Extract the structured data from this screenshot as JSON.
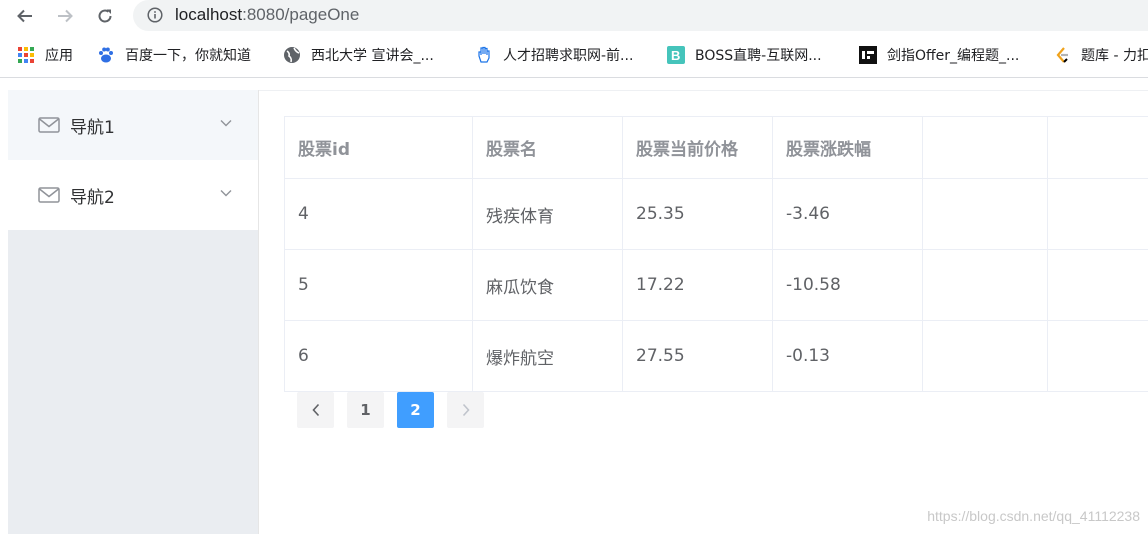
{
  "browser": {
    "url_host": "localhost",
    "url_rest": ":8080/pageOne",
    "bookmarks": [
      {
        "label": "应用",
        "icon": "apps-grid-icon"
      },
      {
        "label": "百度一下，你就知道",
        "icon": "baidu-paw-icon"
      },
      {
        "label": "西北大学 宣讲会_...",
        "icon": "globe-icon"
      },
      {
        "label": "人才招聘求职网-前...",
        "icon": "hand-icon"
      },
      {
        "label": "BOSS直聘-互联网...",
        "icon": "boss-b-icon"
      },
      {
        "label": "剑指Offer_编程题_...",
        "icon": "nowcoder-icon"
      },
      {
        "label": "题库 - 力扣",
        "icon": "leetcode-icon"
      }
    ]
  },
  "sidebar": {
    "items": [
      {
        "label": "导航1",
        "icon": "mail-icon"
      },
      {
        "label": "导航2",
        "icon": "mail-icon"
      }
    ]
  },
  "table": {
    "headers": [
      "股票id",
      "股票名",
      "股票当前价格",
      "股票涨跌幅",
      ""
    ],
    "rows": [
      [
        "4",
        "残疾体育",
        "25.35",
        "-3.46",
        ""
      ],
      [
        "5",
        "麻瓜饮食",
        "17.22",
        "-10.58",
        ""
      ],
      [
        "6",
        "爆炸航空",
        "27.55",
        "-0.13",
        ""
      ]
    ]
  },
  "pagination": {
    "pages": [
      "1",
      "2"
    ],
    "current": "2"
  },
  "watermark": "https://blog.csdn.net/qq_41112238",
  "colors": {
    "accent": "#409eff",
    "sidebar_bg": "#eaedf1",
    "table_border": "#ebeef5"
  }
}
